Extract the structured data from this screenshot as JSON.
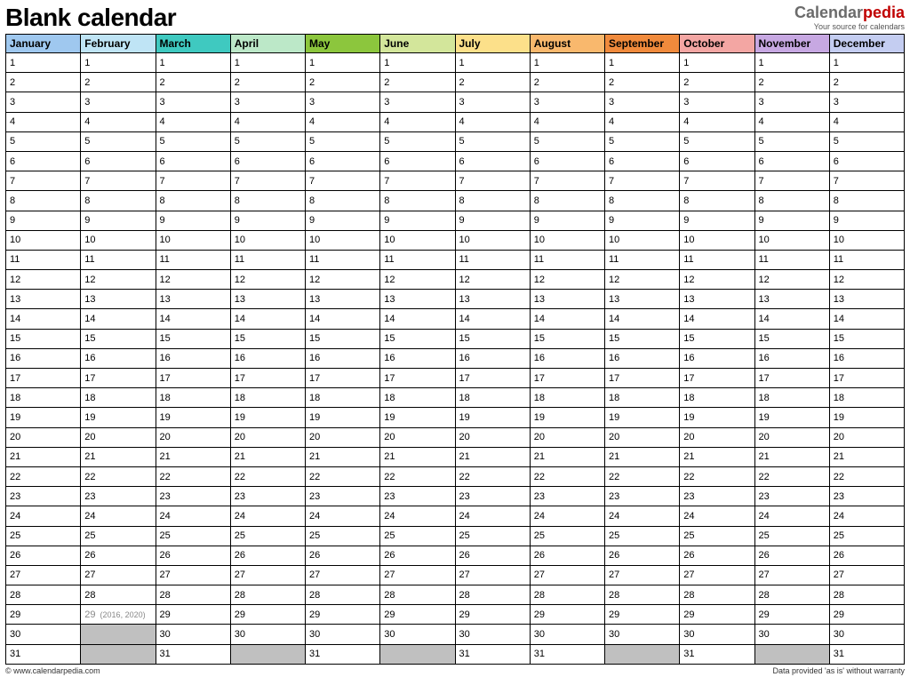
{
  "header": {
    "title": "Blank calendar",
    "brand_cal": "Calendar",
    "brand_pedia": "pedia",
    "brand_tag": "Your source for calendars"
  },
  "months": [
    {
      "name": "January",
      "color": "#9fc8ef",
      "days": 31
    },
    {
      "name": "February",
      "color": "#bfe4f5",
      "days": 29,
      "day29note": "(2016, 2020)"
    },
    {
      "name": "March",
      "color": "#3fc9c0",
      "days": 31
    },
    {
      "name": "April",
      "color": "#bce8c8",
      "days": 30
    },
    {
      "name": "May",
      "color": "#8cc63d",
      "days": 31
    },
    {
      "name": "June",
      "color": "#d3e69b",
      "days": 30
    },
    {
      "name": "July",
      "color": "#fce08a",
      "days": 31
    },
    {
      "name": "August",
      "color": "#f9b86d",
      "days": 31
    },
    {
      "name": "September",
      "color": "#f08a3c",
      "days": 30
    },
    {
      "name": "October",
      "color": "#f3a6a3",
      "days": 31
    },
    {
      "name": "November",
      "color": "#c7a8e2",
      "days": 30
    },
    {
      "name": "December",
      "color": "#c4cdf1",
      "days": 31
    }
  ],
  "rows": 31,
  "footer": {
    "left": "© www.calendarpedia.com",
    "right": "Data provided 'as is' without warranty"
  }
}
